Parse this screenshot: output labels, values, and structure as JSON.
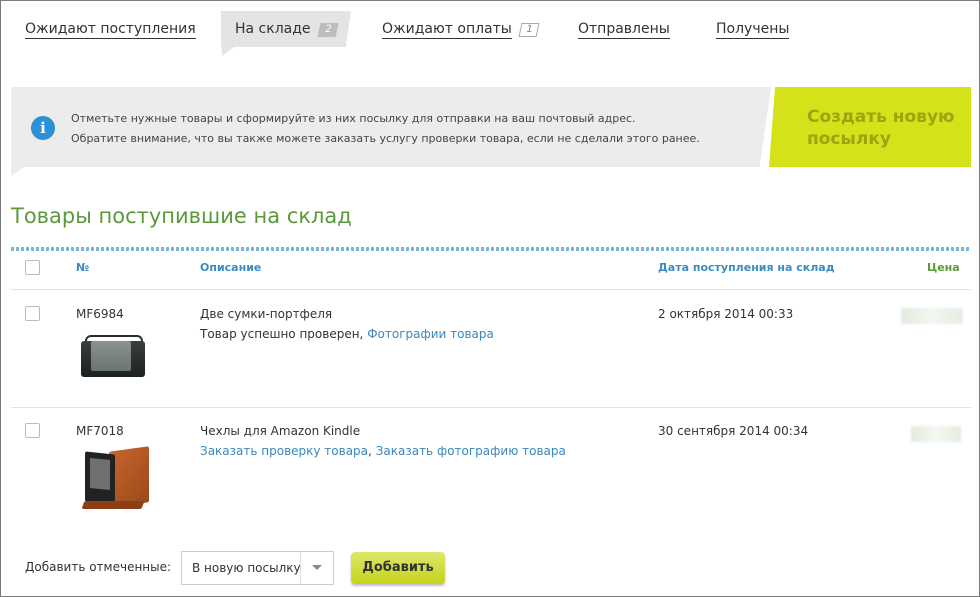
{
  "tabs": [
    {
      "label": "Ожидают поступления",
      "badge": ""
    },
    {
      "label": "На складе",
      "badge": "2"
    },
    {
      "label": "Ожидают оплаты",
      "badge": "1"
    },
    {
      "label": "Отправлены",
      "badge": ""
    },
    {
      "label": "Получены",
      "badge": ""
    }
  ],
  "banner": {
    "icon": "info-icon",
    "line1": "Отметьте нужные товары и сформируйте из них посылку для отправки на ваш почтовый адрес.",
    "line2": "Обратите внимание, что вы также можете заказать услугу проверки товара, если не сделали этого ранее.",
    "create_button": "Создать новую посылку"
  },
  "heading": "Товары поступившие на склад",
  "table": {
    "headers": {
      "number": "№",
      "description": "Описание",
      "date": "Дата поступления на склад",
      "price": "Цена"
    },
    "rows": [
      {
        "number": "MF6984",
        "title": "Две сумки-портфеля",
        "note": "Товар успешно проверен,",
        "links": [
          "Фотографии товара"
        ],
        "date": "2 октября 2014 00:33"
      },
      {
        "number": "MF7018",
        "title": "Чехлы для Amazon Kindle",
        "note": "",
        "links": [
          "Заказать проверку товара",
          "Заказать фотографию товара"
        ],
        "link_sep": ",",
        "date": "30 сентября 2014 00:34"
      }
    ]
  },
  "footer": {
    "add_label": "Добавить отмеченные:",
    "select_value": "В новую посылку",
    "add_button": "Добавить"
  },
  "colors": {
    "accent_green": "#5b9a3b",
    "link_blue": "#3a87be",
    "button_lime": "#d4e21a",
    "info_blue": "#2e8fd6"
  }
}
